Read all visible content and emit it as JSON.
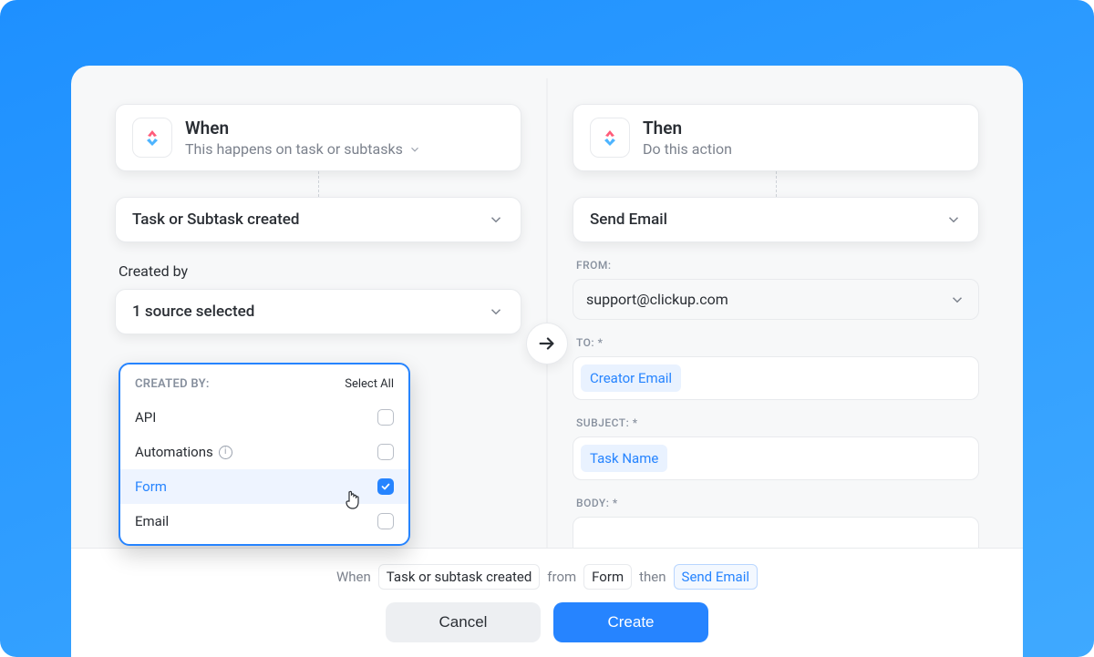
{
  "when": {
    "title": "When",
    "subtitle": "This happens on task or subtasks",
    "trigger_select": "Task or Subtask created",
    "created_by_label": "Created by",
    "source_select": "1 source selected",
    "dropdown": {
      "header": "CREATED BY:",
      "select_all": "Select All",
      "options": [
        {
          "label": "API",
          "checked": false,
          "hover": false,
          "info": false
        },
        {
          "label": "Automations",
          "checked": false,
          "hover": false,
          "info": true
        },
        {
          "label": "Form",
          "checked": true,
          "hover": true,
          "info": false
        },
        {
          "label": "Email",
          "checked": false,
          "hover": false,
          "info": false
        }
      ]
    }
  },
  "then": {
    "title": "Then",
    "subtitle": "Do this action",
    "action_select": "Send Email",
    "from_label": "FROM:",
    "from_value": "support@clickup.com",
    "to_label": "TO: *",
    "to_pill": "Creator Email",
    "subject_label": "SUBJECT: *",
    "subject_pill": "Task Name",
    "body_label": "BODY: *"
  },
  "footer": {
    "when": "When",
    "trigger": "Task or subtask created",
    "from_word": "from",
    "source": "Form",
    "then_word": "then",
    "action": "Send Email",
    "cancel": "Cancel",
    "create": "Create"
  }
}
